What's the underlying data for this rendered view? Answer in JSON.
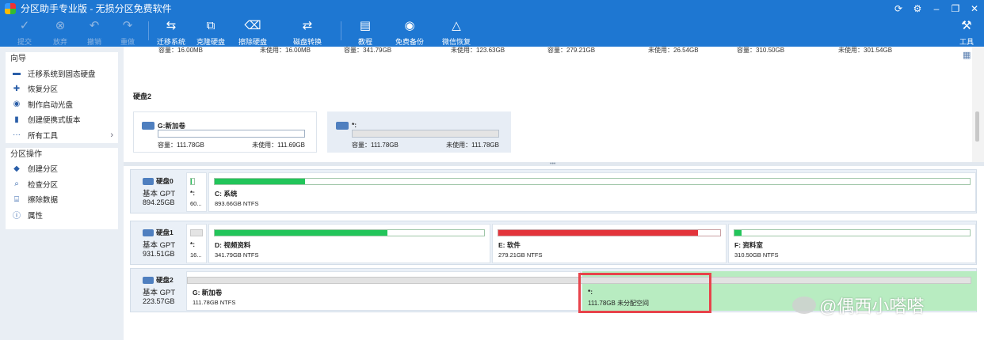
{
  "titlebar": {
    "title": "分区助手专业版 - 无损分区免费软件"
  },
  "toolbar": {
    "items": [
      {
        "label": "提交",
        "icon": "check-icon"
      },
      {
        "label": "放弃",
        "icon": "cancel-icon"
      },
      {
        "label": "撤销",
        "icon": "undo-icon"
      },
      {
        "label": "重做",
        "icon": "redo-icon"
      },
      {
        "label": "迁移系统",
        "icon": "migrate-icon"
      },
      {
        "label": "克隆硬盘",
        "icon": "clone-disk-icon"
      },
      {
        "label": "擦除硬盘",
        "icon": "wipe-disk-icon"
      },
      {
        "label": "磁盘转换",
        "icon": "convert-disk-icon"
      },
      {
        "label": "教程",
        "icon": "tutorial-icon"
      },
      {
        "label": "免费备份",
        "icon": "backup-icon"
      },
      {
        "label": "微信恢复",
        "icon": "recovery-icon"
      },
      {
        "label": "工具",
        "icon": "tools-icon"
      }
    ]
  },
  "sidebar": {
    "wizard_title": "向导",
    "wizard_items": [
      {
        "label": "迁移系统到固态硬盘"
      },
      {
        "label": "恢复分区"
      },
      {
        "label": "制作启动光盘"
      },
      {
        "label": "创建便携式版本"
      },
      {
        "label": "所有工具"
      }
    ],
    "ops_title": "分区操作",
    "ops_items": [
      {
        "label": "创建分区"
      },
      {
        "label": "检查分区"
      },
      {
        "label": "擦除数据"
      },
      {
        "label": "属性"
      }
    ]
  },
  "upper": {
    "cut_cards": [
      {
        "cap": "容量：16.00MB",
        "free": "未使用：16.00MB"
      },
      {
        "cap": "容量：341.79GB",
        "free": "未使用：123.63GB"
      },
      {
        "cap": "容量：279.21GB",
        "free": "未使用：26.54GB"
      },
      {
        "cap": "容量：310.50GB",
        "free": "未使用：301.54GB"
      }
    ],
    "disk2_title": "硬盘2",
    "vol_cards": [
      {
        "name": "G:新加卷",
        "cap": "容量：111.78GB",
        "free": "未使用：111.69GB"
      },
      {
        "name": "*:",
        "cap": "容量：111.78GB",
        "free": "未使用：111.78GB"
      }
    ]
  },
  "disks": [
    {
      "name": "硬盘0",
      "type": "基本 GPT",
      "size": "894.25GB",
      "partitions": [
        {
          "name": "*:",
          "info": "60...",
          "used": 0.15
        },
        {
          "name": "C: 系统",
          "info": "893.66GB NTFS",
          "used": 0.12
        }
      ]
    },
    {
      "name": "硬盘1",
      "type": "基本 GPT",
      "size": "931.51GB",
      "partitions": [
        {
          "name": "*:",
          "info": "16...",
          "used": 0
        },
        {
          "name": "D: 视频资料",
          "info": "341.79GB NTFS",
          "used": 0.64
        },
        {
          "name": "E: 软件",
          "info": "279.21GB NTFS",
          "used": 0.9
        },
        {
          "name": "F: 资料室",
          "info": "310.50GB NTFS",
          "used": 0.03
        }
      ]
    },
    {
      "name": "硬盘2",
      "type": "基本 GPT",
      "size": "223.57GB",
      "partitions": [
        {
          "name": "G: 新加卷",
          "info": "111.78GB NTFS",
          "used": 0
        },
        {
          "name": "*:",
          "info": "111.78GB 未分配空间",
          "used": 0
        }
      ]
    }
  ],
  "colors": {
    "green": "#22c55a",
    "red": "#e3343b",
    "accent": "#1e77d2"
  },
  "watermark": "@偶西小嗒嗒"
}
